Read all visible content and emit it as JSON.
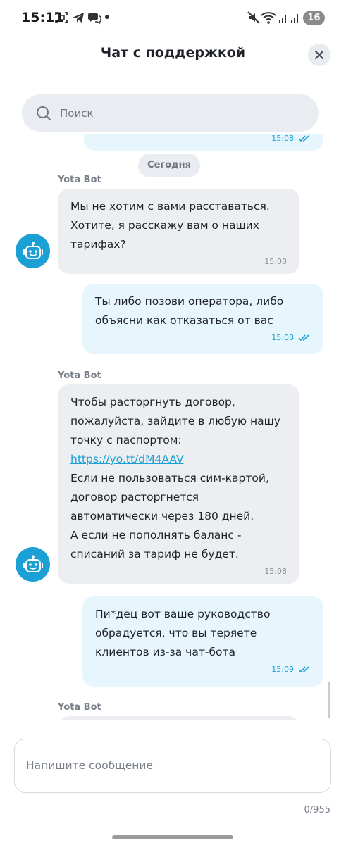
{
  "status_bar": {
    "time": "15:11",
    "battery": "16"
  },
  "header": {
    "title": "Чат с поддержкой"
  },
  "search": {
    "placeholder": "Поиск"
  },
  "chat": {
    "prev_time": "15:08",
    "date_divider": "Сегодня",
    "messages": [
      {
        "sender": "Yota Bot",
        "lines": [
          "Мы не хотим с вами расставаться.",
          "Хотите, я расскажу вам о наших",
          "тарифах?"
        ],
        "time": "15:08"
      },
      {
        "lines": [
          "Ты либо позови оператора, либо",
          "объясни как отказаться от вас"
        ],
        "time": "15:08"
      },
      {
        "sender": "Yota Bot",
        "lines": [
          "Чтобы расторгнуть договор,",
          "пожалуйста, зайдите в любую нашу",
          "точку с паспортом:"
        ],
        "link": "https://yo.tt/dM4AAV",
        "lines_after": [
          "Если не пользоваться сим-картой,",
          "договор расторгнется",
          "автоматически через 180 дней.",
          "А если не пополнять баланс -",
          "списаний за тариф не будет."
        ],
        "time": "15:08"
      },
      {
        "lines": [
          "Пи*дец вот ваше руководство",
          "обрадуется, что вы теряете",
          "клиентов из-за чат-бота"
        ],
        "time": "15:09"
      },
      {
        "sender": "Yota Bot"
      }
    ]
  },
  "composer": {
    "placeholder": "Напишите сообщение",
    "char_count": "0/955"
  },
  "colors": {
    "accent": "#1aa0d5",
    "bot_bubble": "#eceef2",
    "user_bubble": "#e7f5fc"
  }
}
